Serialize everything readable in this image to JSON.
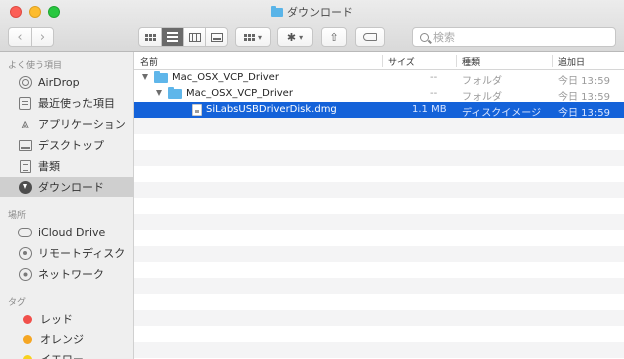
{
  "window": {
    "title": "ダウンロード"
  },
  "toolbar": {
    "search_placeholder": "検索"
  },
  "sidebar": {
    "favorites_heading": "よく使う項目",
    "favorites": [
      {
        "label": "AirDrop",
        "icon": "airdrop-icon"
      },
      {
        "label": "最近使った項目",
        "icon": "recents-icon"
      },
      {
        "label": "アプリケーション",
        "icon": "applications-icon"
      },
      {
        "label": "デスクトップ",
        "icon": "desktop-icon"
      },
      {
        "label": "書類",
        "icon": "documents-icon"
      },
      {
        "label": "ダウンロード",
        "icon": "downloads-icon",
        "selected": true
      }
    ],
    "locations_heading": "場所",
    "locations": [
      {
        "label": "iCloud Drive",
        "icon": "icloud-icon"
      },
      {
        "label": "リモートディスク",
        "icon": "remote-disc-icon"
      },
      {
        "label": "ネットワーク",
        "icon": "network-icon"
      }
    ],
    "tags_heading": "タグ",
    "tags": [
      {
        "label": "レッド",
        "color": "#f1504b"
      },
      {
        "label": "オレンジ",
        "color": "#f5a623"
      },
      {
        "label": "イエロー",
        "color": "#f7d21f"
      }
    ]
  },
  "columns": {
    "name": "名前",
    "size": "サイズ",
    "kind": "種類",
    "date": "追加日"
  },
  "files": [
    {
      "name": "Mac_OSX_VCP_Driver",
      "size": "--",
      "kind": "フォルダ",
      "date": "今日 13:59",
      "level": 0,
      "type": "folder",
      "expanded": true
    },
    {
      "name": "Mac_OSX_VCP_Driver",
      "size": "--",
      "kind": "フォルダ",
      "date": "今日 13:59",
      "level": 1,
      "type": "folder",
      "expanded": true
    },
    {
      "name": "SiLabsUSBDriverDisk.dmg",
      "size": "1.1 MB",
      "kind": "ディスクイメージ",
      "date": "今日 13:59",
      "level": 2,
      "type": "dmg",
      "selected": true
    }
  ],
  "colors": {
    "selection": "#1462d9",
    "folder": "#5fb6ea"
  }
}
